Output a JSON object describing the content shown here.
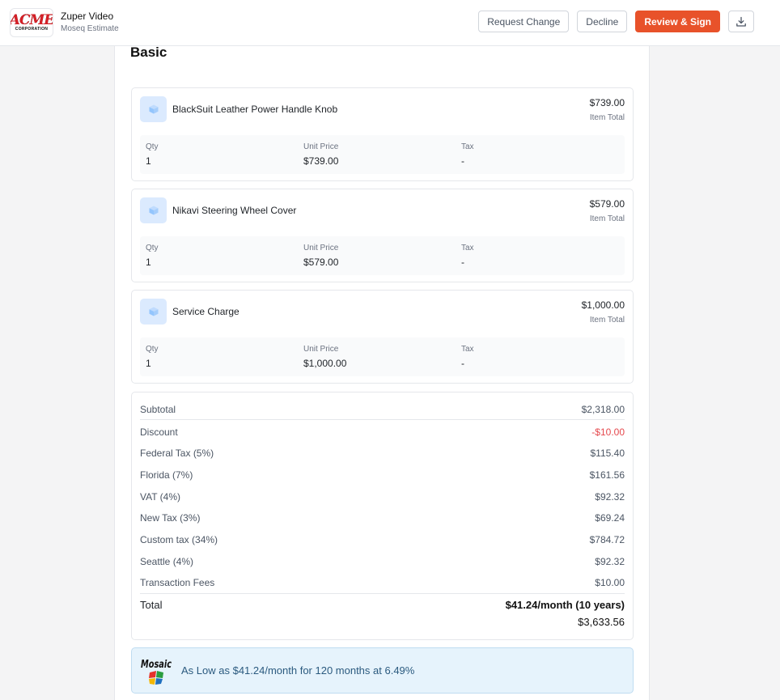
{
  "header": {
    "logo_main": "ACME",
    "logo_sub": "CORPORATION",
    "title": "Zuper Video",
    "subtitle": "Moseq Estimate",
    "actions": {
      "request_change": "Request Change",
      "decline": "Decline",
      "review_sign": "Review & Sign"
    },
    "download_icon": "download-icon",
    "accent_color": "#e8522a"
  },
  "section": {
    "title": "Basic"
  },
  "items": [
    {
      "name": "BlackSuit Leather Power Handle Knob",
      "total": "$739.00",
      "total_label": "Item Total",
      "qty_label": "Qty",
      "qty": "1",
      "unit_price_label": "Unit Price",
      "unit_price": "$739.00",
      "tax_label": "Tax",
      "tax": "-"
    },
    {
      "name": "Nikavi Steering Wheel Cover",
      "total": "$579.00",
      "total_label": "Item Total",
      "qty_label": "Qty",
      "qty": "1",
      "unit_price_label": "Unit Price",
      "unit_price": "$579.00",
      "tax_label": "Tax",
      "tax": "-"
    },
    {
      "name": "Service Charge",
      "total": "$1,000.00",
      "total_label": "Item Total",
      "qty_label": "Qty",
      "qty": "1",
      "unit_price_label": "Unit Price",
      "unit_price": "$1,000.00",
      "tax_label": "Tax",
      "tax": "-"
    }
  ],
  "summary": {
    "rows": [
      {
        "label": "Subtotal",
        "value": "$2,318.00"
      },
      {
        "label": "Discount",
        "value": "-$10.00"
      },
      {
        "label": "Federal Tax (5%)",
        "value": "$115.40"
      },
      {
        "label": "Florida (7%)",
        "value": "$161.56"
      },
      {
        "label": "VAT (4%)",
        "value": "$92.32"
      },
      {
        "label": "New Tax (3%)",
        "value": "$69.24"
      },
      {
        "label": "Custom tax (34%)",
        "value": "$784.72"
      },
      {
        "label": "Seattle (4%)",
        "value": "$92.32"
      },
      {
        "label": "Transaction Fees",
        "value": "$10.00"
      }
    ],
    "total_label": "Total",
    "total_monthly": "$41.24/month (10 years)",
    "total_amount": "$3,633.56",
    "discount_color": "#e5484d"
  },
  "financing": {
    "logo_text": "Mosaic",
    "text": "As Low as $41.24/month for 120 months at 6.49%"
  }
}
